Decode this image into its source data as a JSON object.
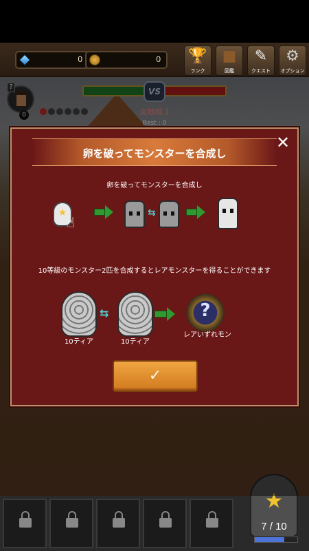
{
  "topbar": {
    "gems": "0",
    "coins": "0",
    "menu": [
      {
        "label": "ランク",
        "icon": "trophy-icon"
      },
      {
        "label": "図鑑",
        "icon": "book-icon"
      },
      {
        "label": "クエスト",
        "icon": "scroll-icon"
      },
      {
        "label": "オプション",
        "icon": "gear-icon"
      }
    ]
  },
  "battle": {
    "vs": "VS",
    "stage_name": "炎地域 1",
    "best": "Best : 0",
    "player_level": "0",
    "player_q": "?"
  },
  "modal": {
    "title": "卵を破ってモンスターを合成し",
    "close": "✕",
    "caption1": "卵を破ってモンスターを合成し",
    "caption2": "10等級のモンスター2匹を合成するとレアモンスターを得ることができます",
    "tier_left": "10ティア",
    "tier_right": "10ティア",
    "rare_label": "レアいずれモン",
    "rare_symbol": "?",
    "confirm": "✓"
  },
  "egg_stock": {
    "count": "7 / 10",
    "progress_fraction": 0.7
  },
  "colors": {
    "modal_bg": "#6a1717",
    "confirm_btn": "#e8912e",
    "arrow_green": "#2f9a2f"
  }
}
